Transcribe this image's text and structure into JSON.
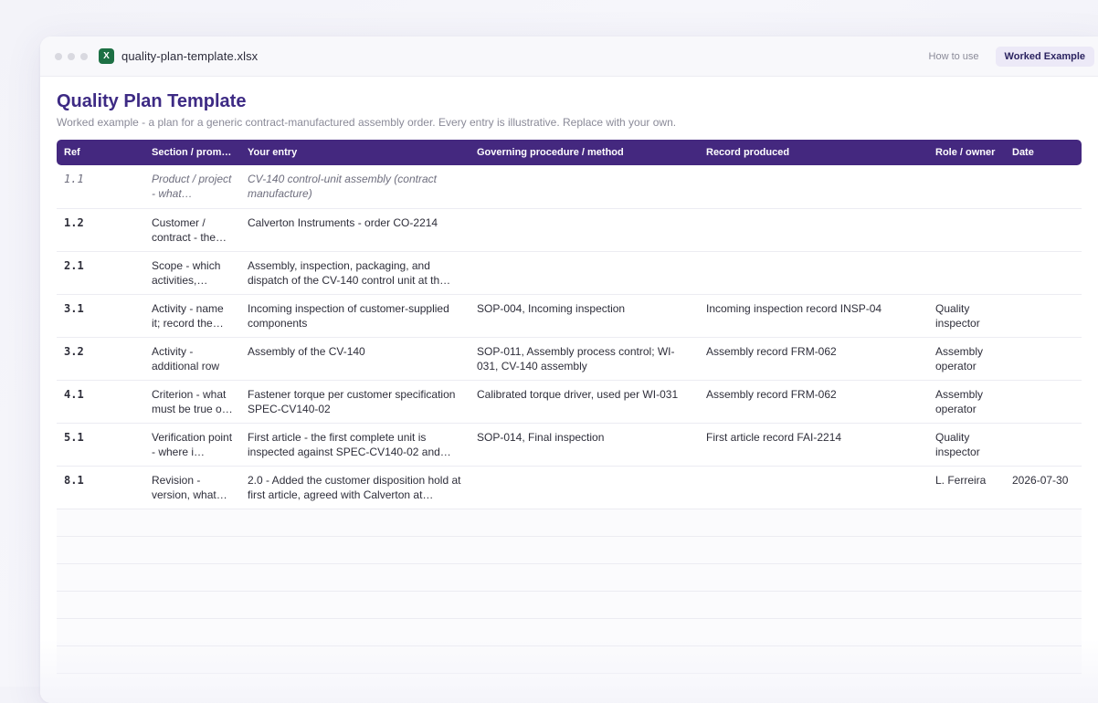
{
  "window": {
    "filename": "quality-plan-template.xlsx",
    "file_icon": "X",
    "tabs": [
      {
        "label": "How to use",
        "active": false
      },
      {
        "label": "Worked Example",
        "active": true
      }
    ]
  },
  "sheet": {
    "title": "Quality Plan Template",
    "subtitle": "Worked example - a plan for a generic contract-manufactured assembly order. Every entry is illustrative. Replace with your own.",
    "columns": [
      "Ref",
      "Section / prom…",
      "Your entry",
      "Governing procedure / method",
      "Record produced",
      "Role / owner",
      "Date"
    ],
    "rows": [
      {
        "ref": "1.1",
        "section": "Product / project - what…",
        "entry": "CV-140 control-unit assembly (contract manufacture)",
        "procedure": "",
        "record": "",
        "role": "",
        "date": "",
        "italic": true
      },
      {
        "ref": "1.2",
        "section": "Customer / contract - the…",
        "entry": "Calverton Instruments - order CO-2214",
        "procedure": "",
        "record": "",
        "role": "",
        "date": ""
      },
      {
        "ref": "2.1",
        "section": "Scope - which activities,…",
        "entry": "Assembly, inspection, packaging, and dispatch of the CV-140 control unit at th…",
        "procedure": "",
        "record": "",
        "role": "",
        "date": ""
      },
      {
        "ref": "3.1",
        "section": "Activity - name it; record the…",
        "entry": "Incoming inspection of customer-supplied components",
        "procedure": "SOP-004, Incoming inspection",
        "record": "Incoming inspection record INSP-04",
        "role": "Quality inspector",
        "date": ""
      },
      {
        "ref": "3.2",
        "section": "Activity - additional row",
        "entry": "Assembly of the CV-140",
        "procedure": "SOP-011, Assembly process control; WI-031, CV-140 assembly",
        "record": "Assembly record FRM-062",
        "role": "Assembly operator",
        "date": ""
      },
      {
        "ref": "4.1",
        "section": "Criterion - what must be true o…",
        "entry": "Fastener torque per customer specification SPEC-CV140-02",
        "procedure": "Calibrated torque driver, used per WI-031",
        "record": "Assembly record FRM-062",
        "role": "Assembly operator",
        "date": ""
      },
      {
        "ref": "5.1",
        "section": "Verification point - where i…",
        "entry": "First article - the first complete unit is inspected against SPEC-CV140-02 and…",
        "procedure": "SOP-014, Final inspection",
        "record": "First article record FAI-2214",
        "role": "Quality inspector",
        "date": ""
      },
      {
        "ref": "8.1",
        "section": "Revision - version, what…",
        "entry": "2.0 - Added the customer disposition hold at first article, agreed with Calverton at…",
        "procedure": "",
        "record": "",
        "role": "L. Ferreira",
        "date": "2026-07-30"
      }
    ],
    "blank_rows": 6
  }
}
